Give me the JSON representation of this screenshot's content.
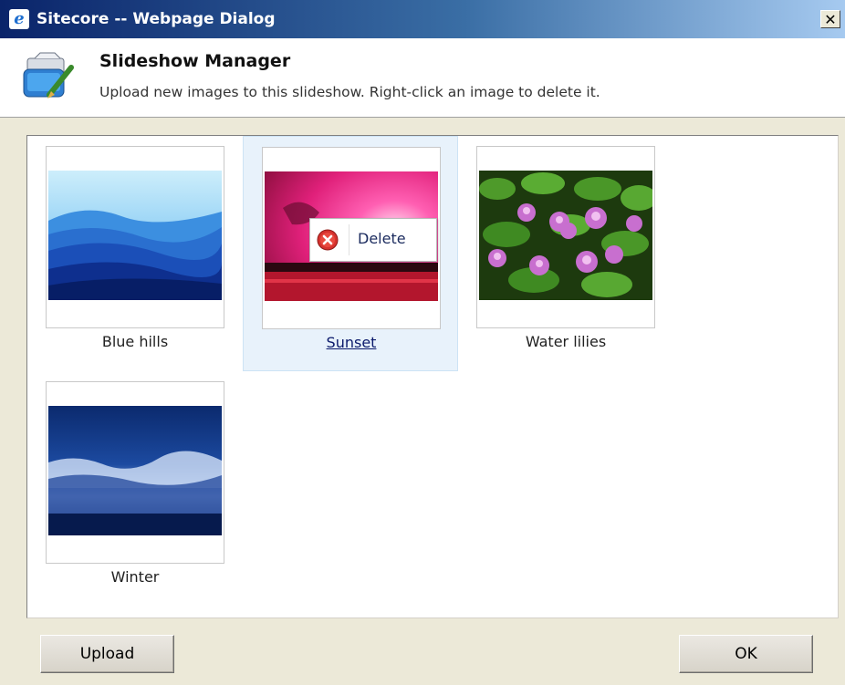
{
  "window": {
    "title": "Sitecore -- Webpage Dialog",
    "close_glyph": "✕",
    "icon_glyph": "e"
  },
  "header": {
    "title": "Slideshow Manager",
    "description": "Upload new images to this slideshow. Right-click an image to delete it."
  },
  "images": [
    {
      "caption": "Blue hills",
      "selected": false
    },
    {
      "caption": "Sunset",
      "selected": true
    },
    {
      "caption": "Water lilies",
      "selected": false
    },
    {
      "caption": "Winter",
      "selected": false
    }
  ],
  "context_menu": {
    "items": [
      {
        "label": "Delete",
        "icon": "delete-icon"
      }
    ]
  },
  "buttons": {
    "upload": "Upload",
    "ok": "OK"
  },
  "colors": {
    "titlebar_start": "#0a246a",
    "titlebar_end": "#a6caf0",
    "selection_bg": "#e8f2fb",
    "delete_icon": "#d6322e"
  }
}
